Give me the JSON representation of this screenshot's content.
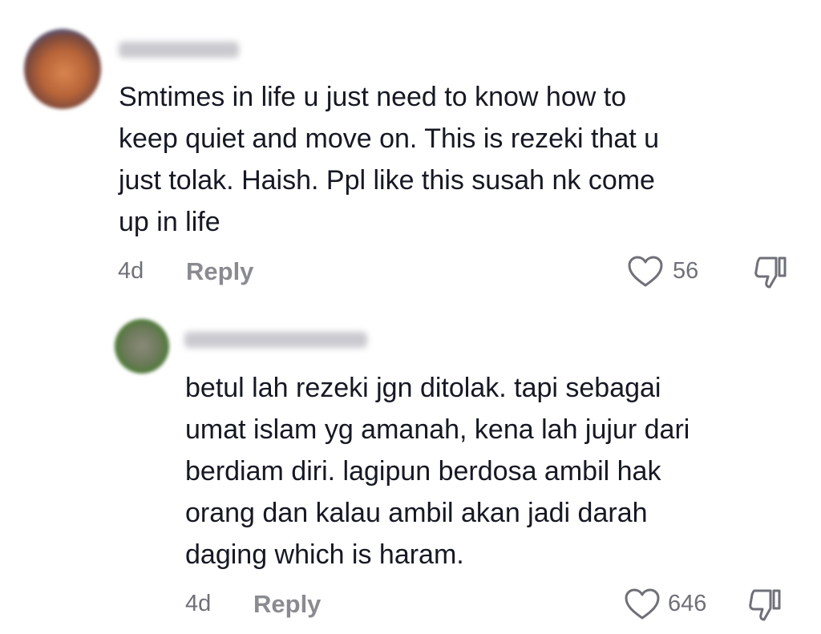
{
  "comments": [
    {
      "text": "Smtimes in life u just need to know how to\nkeep quiet and move on. This is rezeki that u\njust tolak. Haish. Ppl like this susah nk come\nup in life",
      "time": "4d",
      "reply_label": "Reply",
      "likes": "56"
    },
    {
      "text": "betul lah rezeki jgn ditolak. tapi sebagai\numat islam yg amanah, kena lah jujur dari\nberdiam diri. lagipun berdosa ambil hak\norang dan kalau ambil akan jadi darah\ndaging which is haram.",
      "time": "4d",
      "reply_label": "Reply",
      "likes": "646"
    }
  ],
  "icons": {
    "like": "heart-icon",
    "dislike": "thumbs-down-icon"
  },
  "colors": {
    "text": "#161823",
    "meta": "#6f7078",
    "reply": "#8a8b91"
  }
}
